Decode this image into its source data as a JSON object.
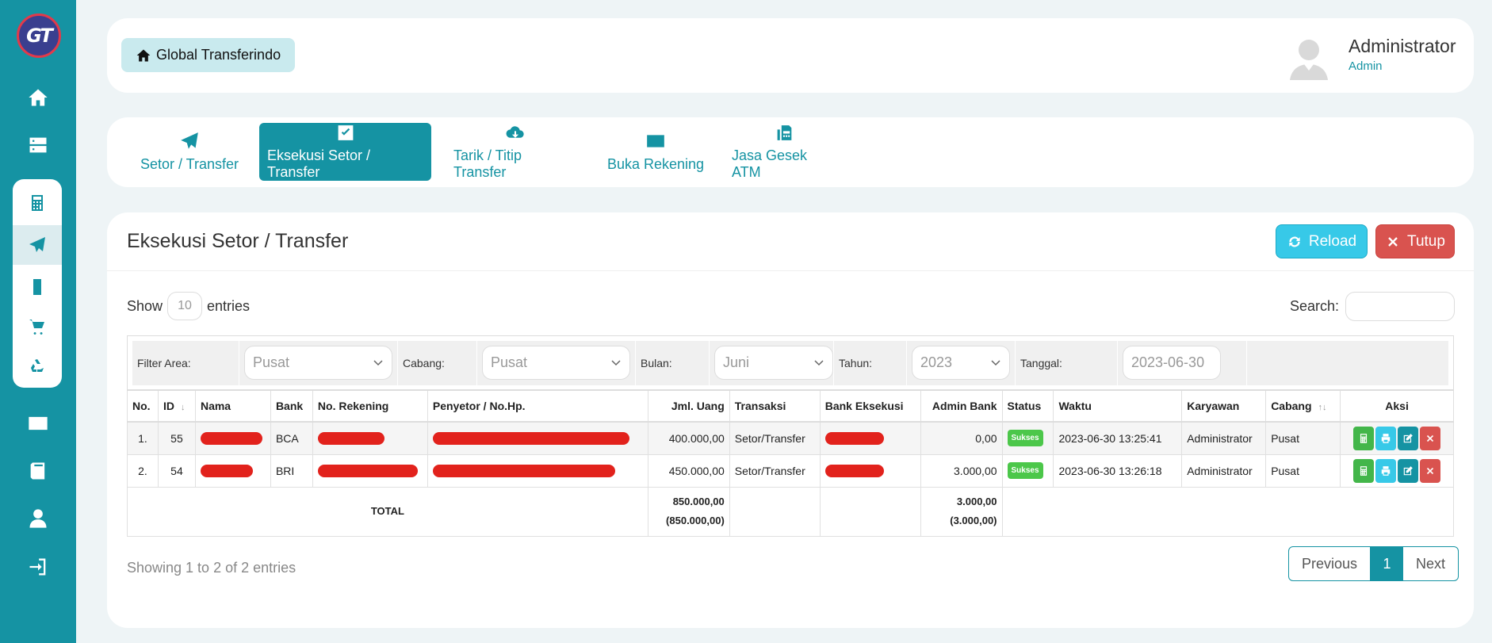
{
  "logo": {
    "text": "GT"
  },
  "header": {
    "brand": "Global Transferindo",
    "user_name": "Administrator",
    "user_role": "Admin"
  },
  "tabs": [
    {
      "label": "Setor / Transfer",
      "icon": "paper-plane-icon",
      "active": false
    },
    {
      "label": "Eksekusi Setor / Transfer",
      "icon": "check-square-icon",
      "active": true
    },
    {
      "label": "Tarik / Titip Transfer",
      "icon": "cloud-download-icon",
      "active": false
    },
    {
      "label": "Buka Rekening",
      "icon": "credit-card-icon",
      "active": false
    },
    {
      "label": "Jasa Gesek ATM",
      "icon": "fax-icon",
      "active": false
    }
  ],
  "card": {
    "title": "Eksekusi Setor / Transfer",
    "reload_label": "Reload",
    "close_label": "Tutup"
  },
  "controls": {
    "show_label": "Show",
    "entries_value": "10",
    "entries_label": "entries",
    "search_label": "Search:"
  },
  "filter": {
    "area_label": "Filter Area:",
    "area_value": "Pusat",
    "cabang_label": "Cabang:",
    "cabang_value": "Pusat",
    "bulan_label": "Bulan:",
    "bulan_value": "Juni",
    "tahun_label": "Tahun:",
    "tahun_value": "2023",
    "tanggal_label": "Tanggal:",
    "tanggal_value": "2023-06-30"
  },
  "table": {
    "headers": {
      "no": "No.",
      "id": "ID",
      "nama": "Nama",
      "bank": "Bank",
      "rekening": "No. Rekening",
      "penyetor": "Penyetor / No.Hp.",
      "jml": "Jml. Uang",
      "transaksi": "Transaksi",
      "bank_eksekusi": "Bank Eksekusi",
      "admin_bank": "Admin Bank",
      "status": "Status",
      "waktu": "Waktu",
      "karyawan": "Karyawan",
      "cabang": "Cabang",
      "aksi": "Aksi"
    },
    "rows": [
      {
        "no": "1.",
        "id": "55",
        "bank": "BCA",
        "jml": "400.000,00",
        "transaksi": "Setor/Transfer",
        "admin_bank": "0,00",
        "status": "Sukses",
        "waktu": "2023-06-30 13:25:41",
        "karyawan": "Administrator",
        "cabang": "Pusat"
      },
      {
        "no": "2.",
        "id": "54",
        "bank": "BRI",
        "jml": "450.000,00",
        "transaksi": "Setor/Transfer",
        "admin_bank": "3.000,00",
        "status": "Sukses",
        "waktu": "2023-06-30 13:26:18",
        "karyawan": "Administrator",
        "cabang": "Pusat"
      }
    ],
    "total": {
      "label": "TOTAL",
      "jml": "850.000,00",
      "jml_sub": "(850.000,00)",
      "admin": "3.000,00",
      "admin_sub": "(3.000,00)"
    }
  },
  "footer": {
    "info": "Showing 1 to 2 of 2 entries",
    "previous": "Previous",
    "page": "1",
    "next": "Next"
  },
  "colors": {
    "primary": "#1593a3",
    "reload": "#37c9e8",
    "danger": "#d9534f",
    "success": "#43b64a",
    "redaction": "#e2221c"
  }
}
